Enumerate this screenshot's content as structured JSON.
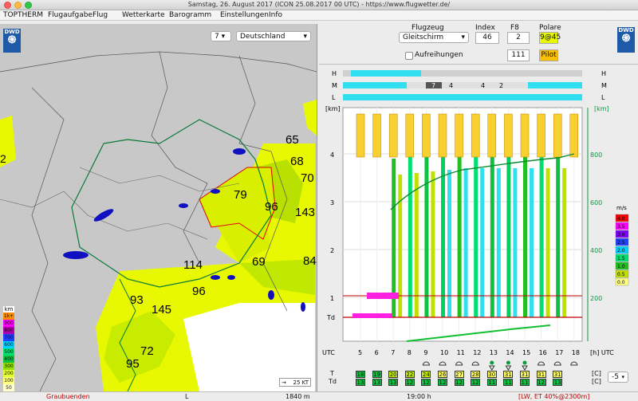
{
  "window": {
    "title": "Samstag, 26. August 2017 (ICON 25.08.2017 00 UTC) - https://www.flugwetter.de/"
  },
  "menu": [
    {
      "label": "TOPTHERM"
    },
    {
      "label": "Flugaufgabe"
    },
    {
      "label": "Flug"
    },
    {
      "label": "Wetterkarte"
    },
    {
      "label": "Barogramm"
    },
    {
      "label": "Einstellungen"
    },
    {
      "label": "Info"
    }
  ],
  "map": {
    "logo": "DWD",
    "zoom_select": "7",
    "region_select": "Deutschland",
    "scale_label": "25 KT",
    "numbers": [
      "65",
      "68",
      "70",
      "79",
      "96",
      "143",
      "114",
      "69",
      "84",
      "96",
      "93",
      "145",
      "72",
      "95",
      "2"
    ],
    "legend_title": "km",
    "legend": [
      {
        "label": "1k+",
        "color": "#ff8c00"
      },
      {
        "label": "900",
        "color": "#ff00ff"
      },
      {
        "label": "800",
        "color": "#b000b0"
      },
      {
        "label": "700",
        "color": "#2040ff"
      },
      {
        "label": "600",
        "color": "#00d0ff"
      },
      {
        "label": "500",
        "color": "#00e070"
      },
      {
        "label": "400",
        "color": "#10c040"
      },
      {
        "label": "300",
        "color": "#90e000"
      },
      {
        "label": "200",
        "color": "#e0ff30"
      },
      {
        "label": "100",
        "color": "#ffff80"
      },
      {
        "label": "50",
        "color": "#ffffd0"
      }
    ]
  },
  "controls": {
    "flugzeug_label": "Flugzeug",
    "flugzeug_value": "Gleitschirm",
    "index_label": "Index",
    "index_value": "46",
    "f8_label": "F8",
    "f8_value": "2",
    "polare_label": "Polare",
    "polare_value": "9@45",
    "aufreihungen_label": "Aufreihungen",
    "f8_second": "111",
    "pilot_label": "Pilot",
    "dwd": "DWD"
  },
  "meteogram": {
    "cloud_rows": {
      "H": "H",
      "M": "M",
      "L": "L"
    },
    "mid_cloud_values": [
      "7",
      "4",
      "4",
      "2"
    ],
    "left_axis": [
      "[km]",
      "4",
      "3",
      "2",
      "1",
      "Td"
    ],
    "right_axis": [
      "[km]",
      "800",
      "600",
      "400",
      "200"
    ],
    "utc_label": "UTC",
    "utc_label_right": "[h]  UTC",
    "hours": [
      "5",
      "6",
      "7",
      "8",
      "9",
      "10",
      "11",
      "12",
      "13",
      "14",
      "15",
      "16",
      "17",
      "18"
    ],
    "ms_title": "m/s",
    "ms_legend": [
      {
        "label": "4.0",
        "color": "#ff0000"
      },
      {
        "label": "3.5",
        "color": "#ff00ff"
      },
      {
        "label": "3.0",
        "color": "#8000ff"
      },
      {
        "label": "2.5",
        "color": "#2040ff"
      },
      {
        "label": "2.0",
        "color": "#00d0ff"
      },
      {
        "label": "1.5",
        "color": "#00e070"
      },
      {
        "label": "1.0",
        "color": "#20c020"
      },
      {
        "label": "0.5",
        "color": "#c0e000"
      },
      {
        "label": "0.0",
        "color": "#ffff80"
      }
    ],
    "T_label": "T",
    "Td_label": "Td",
    "unit_C": "[C]",
    "T_values": [
      "18",
      "19",
      "20",
      "22",
      "24",
      "26",
      "27",
      "28",
      "30",
      "31",
      "31",
      "31",
      "31"
    ],
    "Td_values": [
      "13",
      "13",
      "13",
      "12",
      "12",
      "12",
      "12",
      "12",
      "11",
      "11",
      "11",
      "12",
      "13"
    ],
    "minus_select": "-5"
  },
  "status": {
    "region": "Graubuenden",
    "L": "L",
    "height": "1840 m",
    "time": "19:00 h",
    "info": "[LW, ET  40%@2300m]"
  }
}
